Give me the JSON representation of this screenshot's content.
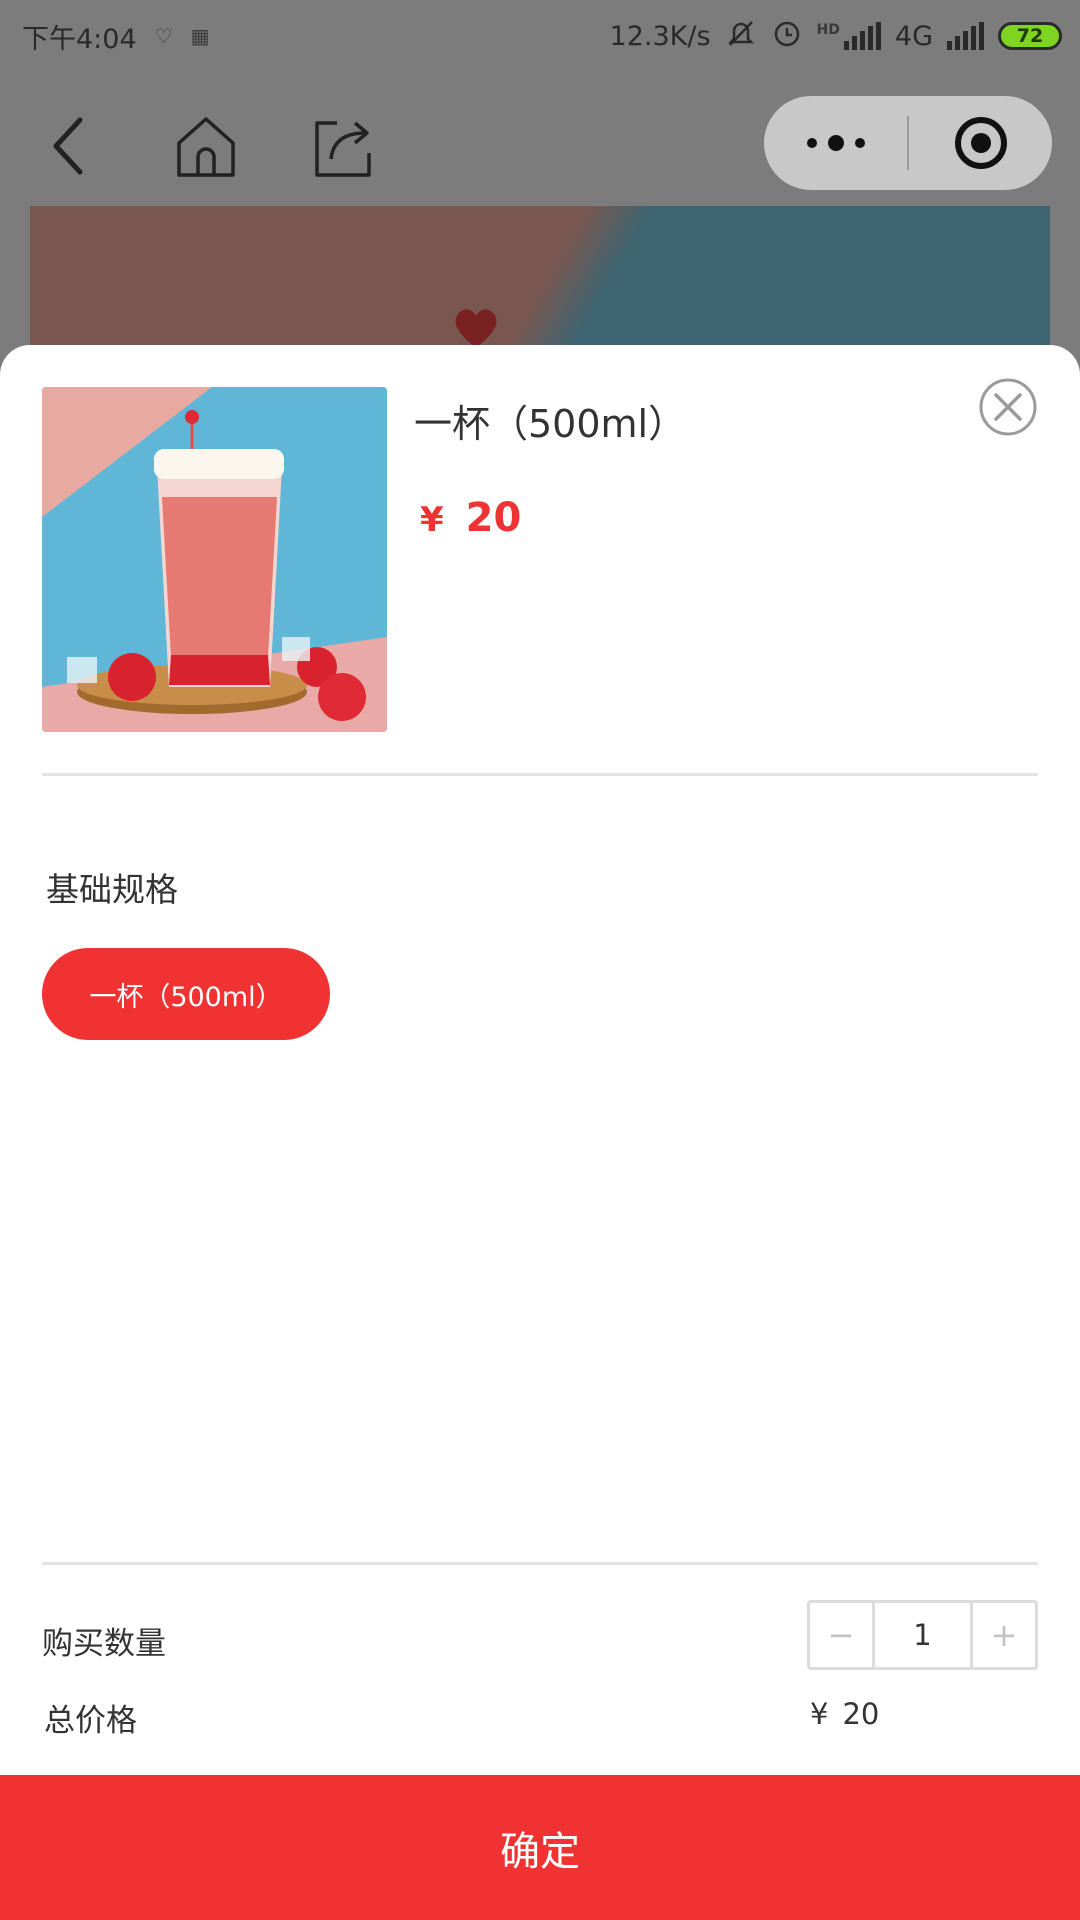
{
  "status_bar": {
    "time": "下午4:04",
    "network_speed": "12.3K/s",
    "network_type": "4G",
    "hd_badge": "HD",
    "battery": "72",
    "icons": [
      "heart-icon",
      "qr-icon",
      "mute-icon",
      "alarm-icon",
      "signal-icon",
      "signal-icon",
      "battery-icon"
    ]
  },
  "nav": {
    "icons": [
      "back-icon",
      "home-icon",
      "share-icon",
      "more-icon",
      "target-icon"
    ]
  },
  "product": {
    "name": "一杯（500ml）",
    "currency": "¥",
    "price": "20"
  },
  "spec": {
    "title": "基础规格",
    "options": [
      {
        "label": "一杯（500ml）",
        "selected": true
      }
    ]
  },
  "quantity": {
    "label": "购买数量",
    "value": "1",
    "minus": "−",
    "plus": "+"
  },
  "total": {
    "label": "总价格",
    "currency": "¥",
    "value": "20"
  },
  "confirm": {
    "label": "确定"
  },
  "colors": {
    "accent": "#f03232",
    "overlay": "#7c7c7c",
    "divider": "#e3e3e3"
  }
}
